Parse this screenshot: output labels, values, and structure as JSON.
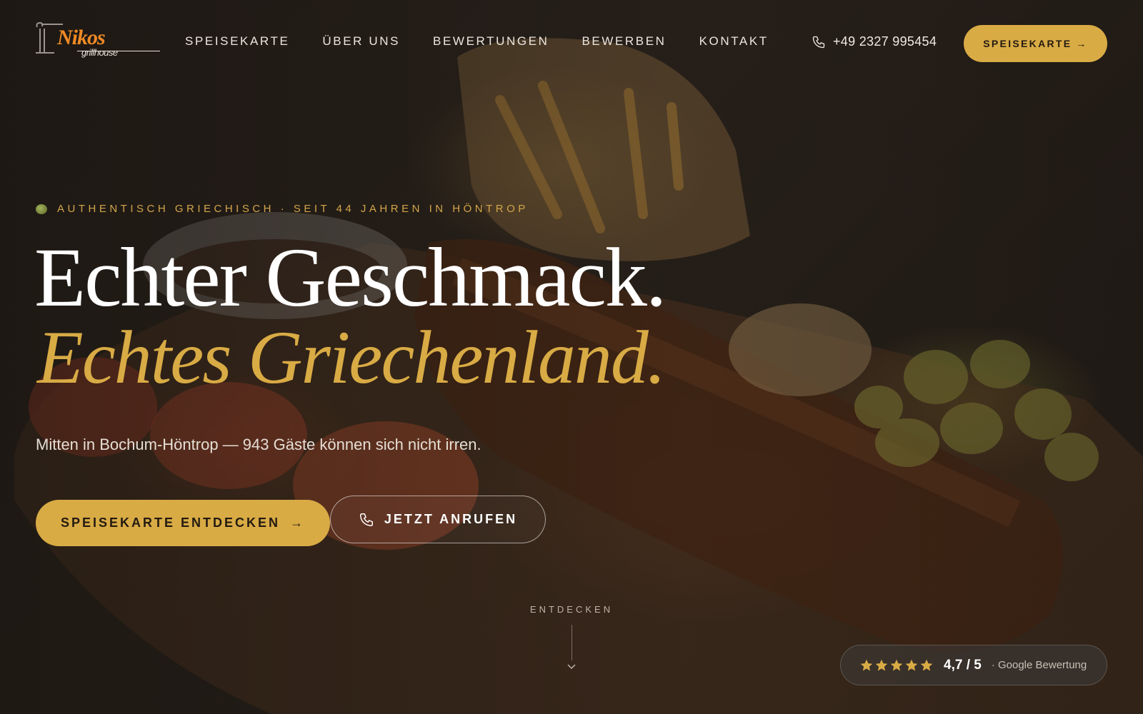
{
  "brand": {
    "logo_main": "Nikos",
    "logo_sub": "grillhouse"
  },
  "nav": {
    "items": [
      {
        "label": "SPEISEKARTE"
      },
      {
        "label": "ÜBER UNS"
      },
      {
        "label": "BEWERTUNGEN"
      },
      {
        "label": "BEWERBEN"
      },
      {
        "label": "KONTAKT"
      }
    ],
    "phone": "+49 2327 995454",
    "cta_label": "SPEISEKARTE",
    "cta_arrow": "→"
  },
  "hero": {
    "eyebrow": "AUTHENTISCH GRIECHISCH · SEIT 44 JAHREN IN HÖNTROP",
    "headline_1": "Echter Geschmack.",
    "headline_2": "Echtes Griechenland.",
    "subline": "Mitten in Bochum-Höntrop — 943 Gäste können sich nicht irren.",
    "primary_cta": "SPEISEKARTE ENTDECKEN",
    "primary_arrow": "→",
    "secondary_cta": "JETZT ANRUFEN",
    "scroll_label": "ENTDECKEN"
  },
  "rating": {
    "stars": 5,
    "score": "4,7 / 5",
    "source": "· Google Bewertung"
  },
  "colors": {
    "accent": "#d9ab45",
    "logo_orange": "#f08a24",
    "background": "#1f1a16"
  },
  "icons": [
    "phone-icon",
    "arrow-right-icon",
    "star-icon",
    "chevron-down-icon",
    "olive-icon"
  ]
}
